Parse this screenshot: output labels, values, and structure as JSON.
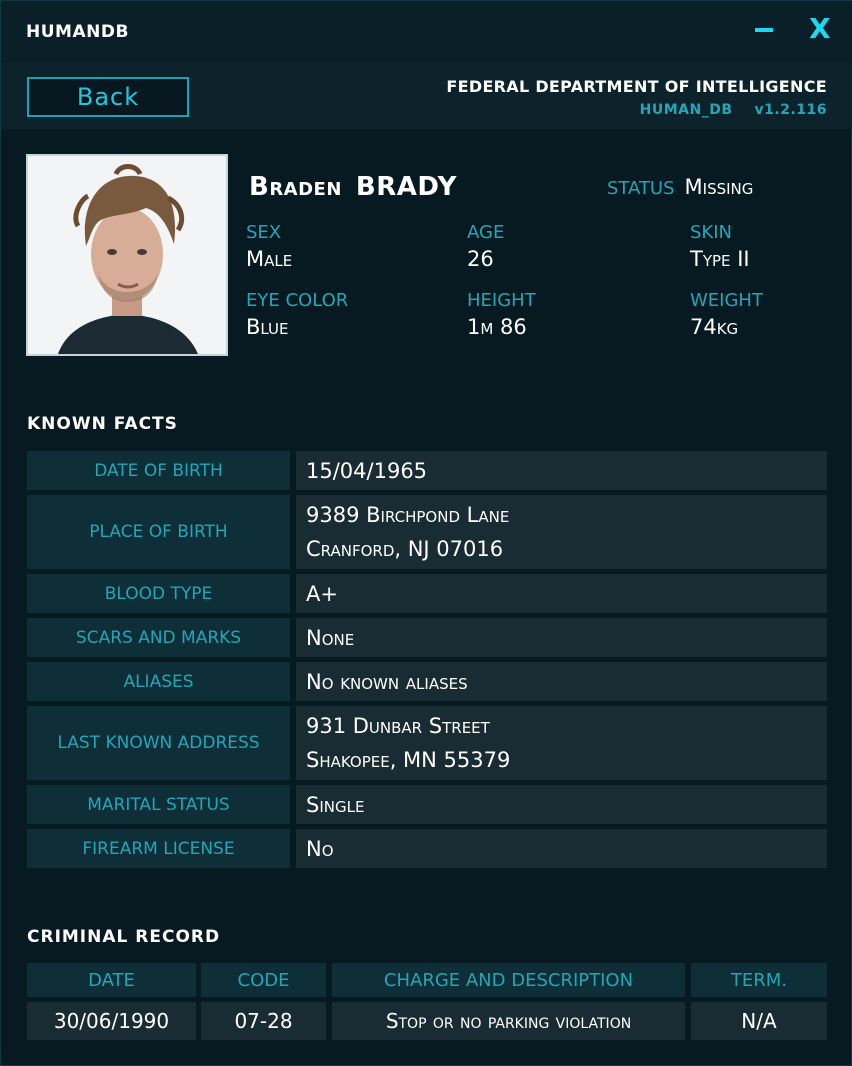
{
  "window": {
    "app_title": "HUMANDB",
    "minimize_glyph": "-",
    "close_glyph": "X"
  },
  "header": {
    "back_label": "Back",
    "agency": "FEDERAL DEPARTMENT OF INTELLIGENCE",
    "db_name": "HUMAN_DB",
    "version": "v1.2.116"
  },
  "profile": {
    "first_name": "Braden",
    "last_name": "BRADY",
    "status_label": "STATUS",
    "status_value": "Missing",
    "attributes": [
      {
        "label": "SEX",
        "value": "Male"
      },
      {
        "label": "AGE",
        "value": "26"
      },
      {
        "label": "SKIN",
        "value": "Type II"
      },
      {
        "label": "EYE COLOR",
        "value": "Blue"
      },
      {
        "label": "HEIGHT",
        "value": "1m 86"
      },
      {
        "label": "WEIGHT",
        "value": "74kg"
      }
    ]
  },
  "known_facts": {
    "title": "KNOWN  FACTS",
    "rows": [
      {
        "label": "DATE OF BIRTH",
        "lines": [
          "15/04/1965"
        ]
      },
      {
        "label": "PLACE OF BIRTH",
        "lines": [
          "9389 Birchpond Lane",
          "Cranford, NJ 07016"
        ]
      },
      {
        "label": "BLOOD TYPE",
        "lines": [
          "A+"
        ]
      },
      {
        "label": "SCARS AND MARKS",
        "lines": [
          "None"
        ]
      },
      {
        "label": "ALIASES",
        "lines": [
          "No known aliases"
        ]
      },
      {
        "label": "LAST KNOWN ADDRESS",
        "lines": [
          "931 Dunbar Street",
          "Shakopee, MN 55379"
        ]
      },
      {
        "label": "MARITAL STATUS",
        "lines": [
          "Single"
        ]
      },
      {
        "label": "FIREARM LICENSE",
        "lines": [
          "No"
        ]
      }
    ]
  },
  "criminal_record": {
    "title": "CRIMINAL  RECORD",
    "columns": [
      "DATE",
      "CODE",
      "CHARGE AND DESCRIPTION",
      "TERM."
    ],
    "rows": [
      [
        "30/06/1990",
        "07-28",
        "Stop or no parking violation",
        "N/A"
      ]
    ]
  },
  "colors": {
    "accent": "#1ed8f0",
    "label": "#23a6b8",
    "background": "#081a21"
  },
  "icons": [
    "minimize-icon",
    "close-icon"
  ]
}
